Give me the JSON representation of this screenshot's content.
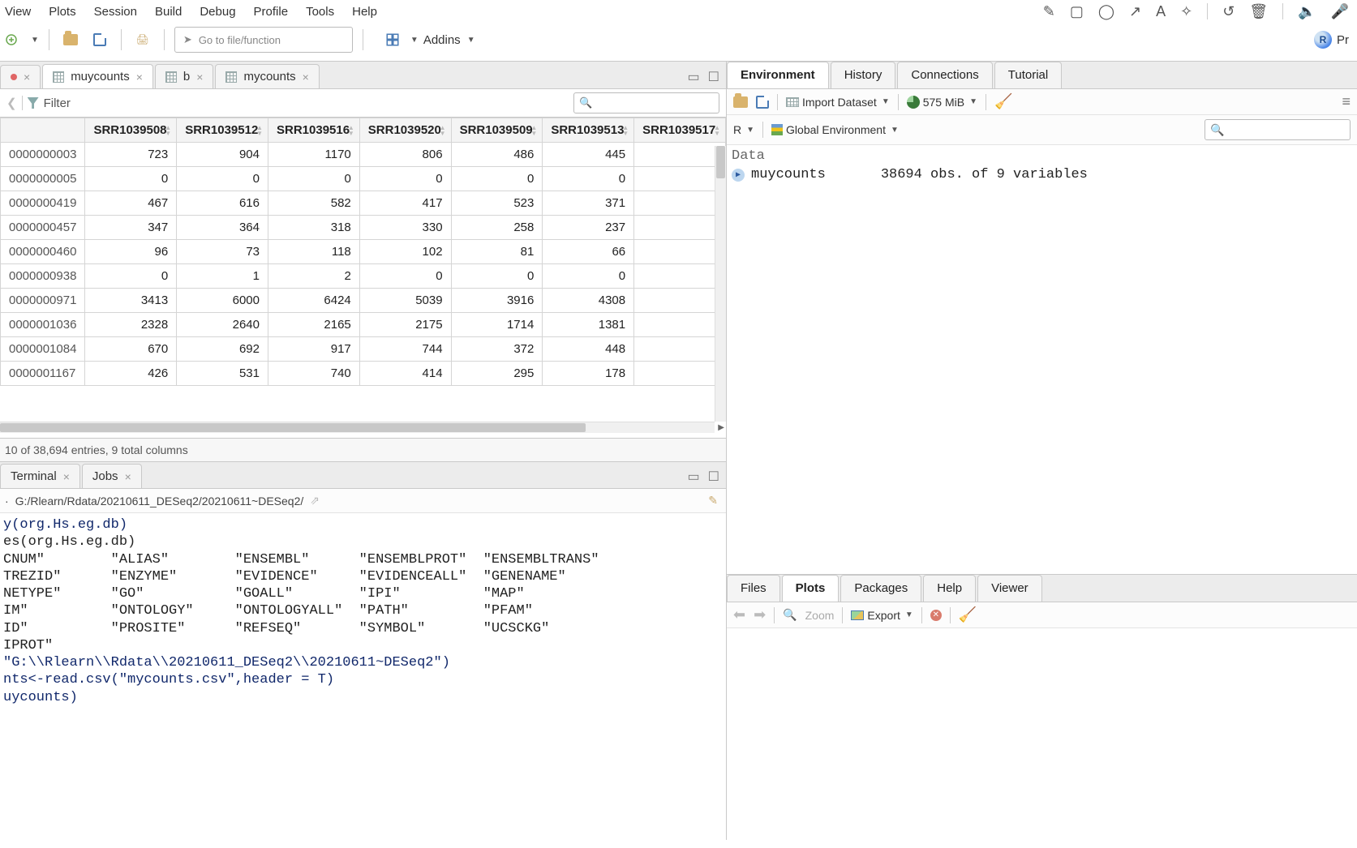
{
  "menus": [
    "View",
    "Plots",
    "Session",
    "Build",
    "Debug",
    "Profile",
    "Tools",
    "Help"
  ],
  "toolbar": {
    "goto_placeholder": "Go to file/function",
    "addins_label": "Addins",
    "project_label": "Pr"
  },
  "source_tabs": [
    {
      "label": "",
      "dirty": true
    },
    {
      "label": "muycounts",
      "active": true,
      "icon": "grid"
    },
    {
      "label": "b",
      "icon": "grid"
    },
    {
      "label": "mycounts",
      "icon": "grid"
    }
  ],
  "filter_label": "Filter",
  "table": {
    "columns": [
      "",
      "SRR1039508",
      "SRR1039512",
      "SRR1039516",
      "SRR1039520",
      "SRR1039509",
      "SRR1039513",
      "SRR1039517"
    ],
    "rows": [
      [
        "0000000003",
        "723",
        "904",
        "1170",
        "806",
        "486",
        "445",
        ""
      ],
      [
        "0000000005",
        "0",
        "0",
        "0",
        "0",
        "0",
        "0",
        ""
      ],
      [
        "0000000419",
        "467",
        "616",
        "582",
        "417",
        "523",
        "371",
        ""
      ],
      [
        "0000000457",
        "347",
        "364",
        "318",
        "330",
        "258",
        "237",
        ""
      ],
      [
        "0000000460",
        "96",
        "73",
        "118",
        "102",
        "81",
        "66",
        ""
      ],
      [
        "0000000938",
        "0",
        "1",
        "2",
        "0",
        "0",
        "0",
        ""
      ],
      [
        "0000000971",
        "3413",
        "6000",
        "6424",
        "5039",
        "3916",
        "4308",
        ""
      ],
      [
        "0000001036",
        "2328",
        "2640",
        "2165",
        "2175",
        "1714",
        "1381",
        ""
      ],
      [
        "0000001084",
        "670",
        "692",
        "917",
        "744",
        "372",
        "448",
        ""
      ],
      [
        "0000001167",
        "426",
        "531",
        "740",
        "414",
        "295",
        "178",
        ""
      ]
    ],
    "status": "10 of 38,694 entries, 9 total columns"
  },
  "console": {
    "tabs": [
      {
        "label": "Terminal"
      },
      {
        "label": "Jobs"
      }
    ],
    "path": "G:/Rlearn/Rdata/20210611_DESeq2/20210611~DESeq2/",
    "lines": [
      {
        "cls": "navy",
        "text": "y(org.Hs.eg.db)"
      },
      {
        "cls": "",
        "text": "es(org.Hs.eg.db)"
      },
      {
        "cls": "",
        "text": "CNUM\"        \"ALIAS\"        \"ENSEMBL\"      \"ENSEMBLPROT\"  \"ENSEMBLTRANS\""
      },
      {
        "cls": "",
        "text": "TREZID\"      \"ENZYME\"       \"EVIDENCE\"     \"EVIDENCEALL\"  \"GENENAME\""
      },
      {
        "cls": "",
        "text": "NETYPE\"      \"GO\"           \"GOALL\"        \"IPI\"          \"MAP\""
      },
      {
        "cls": "",
        "text": "IM\"          \"ONTOLOGY\"     \"ONTOLOGYALL\"  \"PATH\"         \"PFAM\""
      },
      {
        "cls": "",
        "text": "ID\"          \"PROSITE\"      \"REFSEQ\"       \"SYMBOL\"       \"UCSCKG\""
      },
      {
        "cls": "",
        "text": "IPROT\""
      },
      {
        "cls": "navy",
        "text": "\"G:\\\\Rlearn\\\\Rdata\\\\20210611_DESeq2\\\\20210611~DESeq2\")"
      },
      {
        "cls": "navy",
        "text": "nts<-read.csv(\"mycounts.csv\",header = T)"
      },
      {
        "cls": "navy",
        "text": "uycounts)"
      }
    ]
  },
  "env_tabs": [
    "Environment",
    "History",
    "Connections",
    "Tutorial"
  ],
  "env_toolbar": {
    "import_label": "Import Dataset",
    "mem_label": "575 MiB",
    "scope_label": "Global Environment",
    "r_label": "R"
  },
  "env": {
    "heading": "Data",
    "item_name": "muycounts",
    "item_desc": "38694 obs. of 9 variables"
  },
  "plot_tabs": [
    "Files",
    "Plots",
    "Packages",
    "Help",
    "Viewer"
  ],
  "plot_toolbar": {
    "zoom_label": "Zoom",
    "export_label": "Export"
  }
}
